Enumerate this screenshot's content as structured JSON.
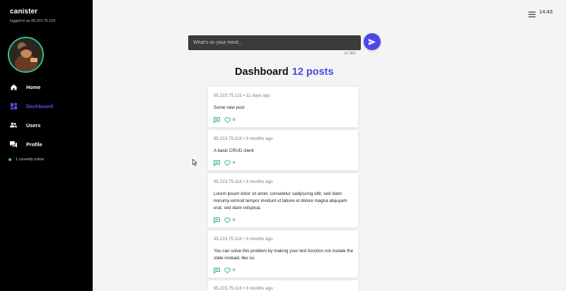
{
  "sidebar": {
    "brand": "canister",
    "login_info": "logged in as 95.223.75.159",
    "items": [
      {
        "label": "Home",
        "icon": "home-icon"
      },
      {
        "label": "Dashboard",
        "icon": "dashboard-icon"
      },
      {
        "label": "Users",
        "icon": "users-icon"
      },
      {
        "label": "Profile",
        "icon": "chat-icon"
      }
    ],
    "online_text": "1 currently online"
  },
  "topbar": {
    "time": "14:43"
  },
  "composer": {
    "placeholder": "What's on your mind...",
    "value": "",
    "counter": "0 / 201"
  },
  "heading": {
    "title": "Dashboard",
    "count": "12 posts"
  },
  "colors": {
    "accent": "#4c48e6",
    "online": "#2fd18f",
    "action": "#1fa57a"
  },
  "posts": [
    {
      "meta": "95.223.75.121 • 11 days ago",
      "body": "Some new post",
      "likes": "0"
    },
    {
      "meta": "95.223.75.118 • 3 months ago",
      "body": "A basic CRUD client",
      "likes": "0"
    },
    {
      "meta": "95.223.75.118 • 3 months ago",
      "body": "Lorem ipsum dolor sit amet, consetetur sadipscing elitr, sed diam nonumy eirmod tempor invidunt ut labore et dolore magna aliquyam erat, sed diam voluptua.",
      "likes": "0"
    },
    {
      "meta": "95.223.75.118 • 3 months ago",
      "body": "You can solve this problem by making your test function not mutate the state instead, like so.",
      "likes": "0"
    },
    {
      "meta": "95.223.75.118 • 3 months ago",
      "body": "",
      "likes": ""
    }
  ]
}
